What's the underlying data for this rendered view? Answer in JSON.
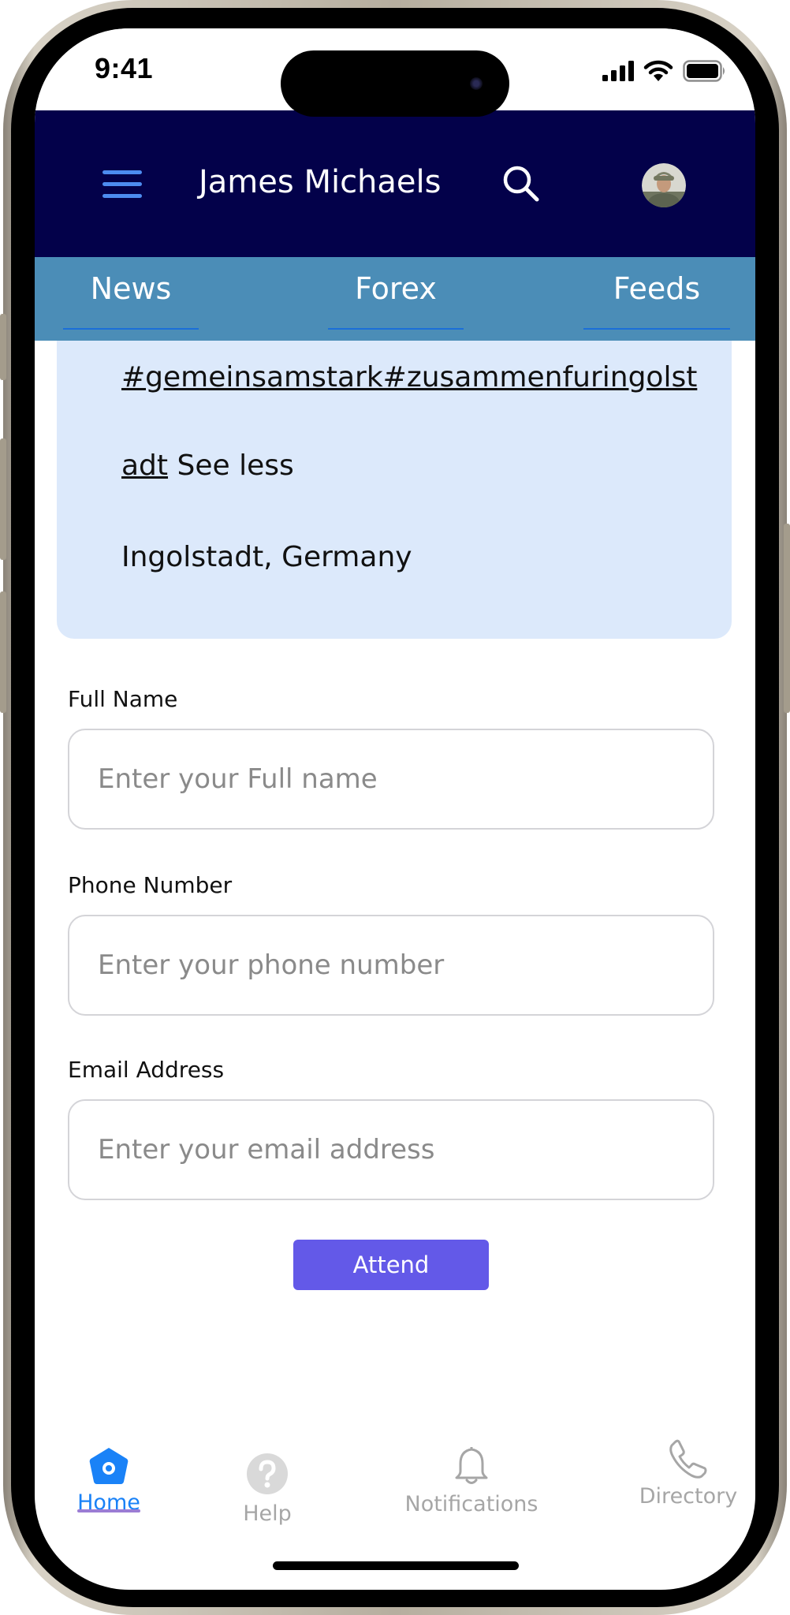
{
  "status_bar": {
    "time": "9:41"
  },
  "header": {
    "title": "James Michaels"
  },
  "tabs": [
    {
      "label": "News"
    },
    {
      "label": "Forex"
    },
    {
      "label": "Feeds"
    }
  ],
  "post": {
    "hashtags": "#gemeinsamstark#zusammenfuringolst",
    "hashtags_cont": "adt",
    "see_less": "See less",
    "location": "Ingolstadt, Germany"
  },
  "form": {
    "full_name": {
      "label": "Full Name",
      "placeholder": "Enter your Full name"
    },
    "phone": {
      "label": "Phone Number",
      "placeholder": "Enter your phone number"
    },
    "email": {
      "label": "Email Address",
      "placeholder": "Enter your email address"
    },
    "submit_label": "Attend"
  },
  "bottom_nav": {
    "items": [
      {
        "label": "Home",
        "icon": "home-icon",
        "active": true
      },
      {
        "label": "Help",
        "icon": "help-icon",
        "active": false
      },
      {
        "label": "Notifications",
        "icon": "bell-icon",
        "active": false
      },
      {
        "label": "Directory",
        "icon": "phone-icon",
        "active": false
      }
    ]
  },
  "colors": {
    "header_bg": "#03014a",
    "tabs_bg": "#4b8db7",
    "card_bg": "#dce9fb",
    "accent": "#6359e8",
    "active_nav": "#1a82f7"
  }
}
